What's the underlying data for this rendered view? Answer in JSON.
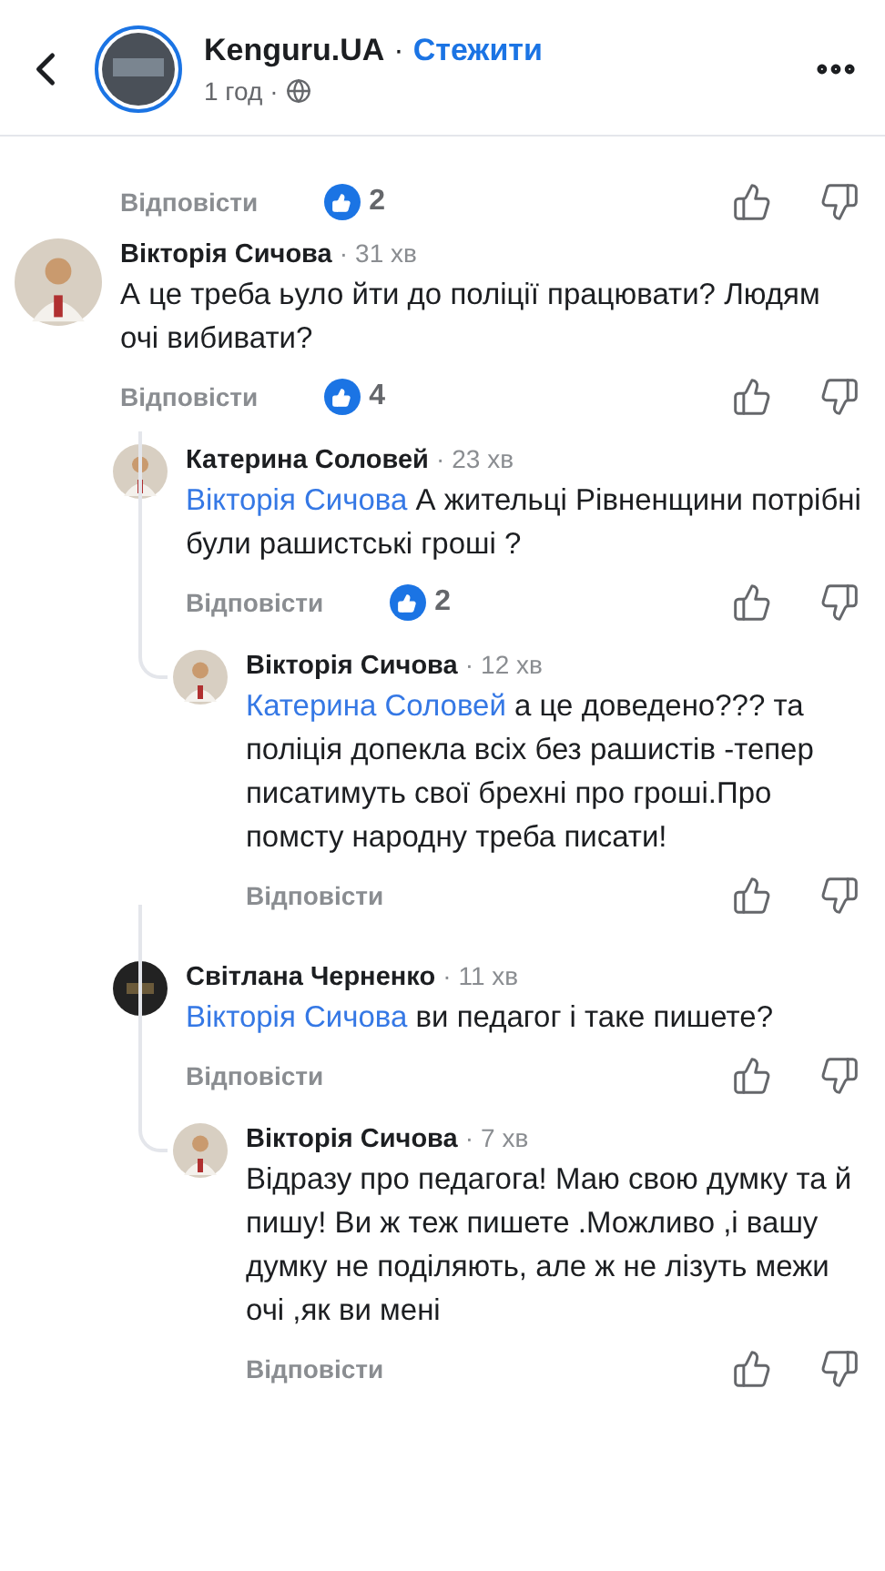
{
  "header": {
    "page_name": "Kenguru.UA",
    "separator": "·",
    "follow_label": "Стежити",
    "time": "1 год",
    "time_separator": "·"
  },
  "comments": [
    {
      "reply_label": "Відповісти",
      "likes": "2"
    },
    {
      "author": "Вікторія Сичова",
      "time": "31 хв",
      "text": "А це треба ьуло йти до поліції працювати? Людям очі вибивати?",
      "reply_label": "Відповісти",
      "likes": "4",
      "children": [
        {
          "author": "Катерина Соловей",
          "time": "23 хв",
          "mention": "Вікторія Сичова",
          "text": "А жительці Рівненщини потрібні були рашистські гроші ?",
          "reply_label": "Відповісти",
          "likes": "2",
          "children": [
            {
              "author": "Вікторія Сичова",
              "time": "12 хв",
              "mention": "Катерина Соловей",
              "text": "а це доведено??? та поліція допекла всіх без рашистів -тепер писатимуть свої брехні про гроші.Про помсту народну треба писати!",
              "reply_label": "Відповісти"
            }
          ]
        },
        {
          "author": "Світлана Черненко",
          "time": "11 хв",
          "mention": "Вікторія Сичова",
          "text": "ви педагог і таке пишете?",
          "reply_label": "Відповісти",
          "children": [
            {
              "author": "Вікторія Сичова",
              "time": "7 хв",
              "text": "Відразу про педагога! Маю свою думку та й пишу! Ви ж теж пишете .Можливо ,і вашу думку не поділяють, але ж не лізуть межи очі ,як ви мені",
              "reply_label": "Відповісти"
            }
          ]
        }
      ]
    }
  ]
}
